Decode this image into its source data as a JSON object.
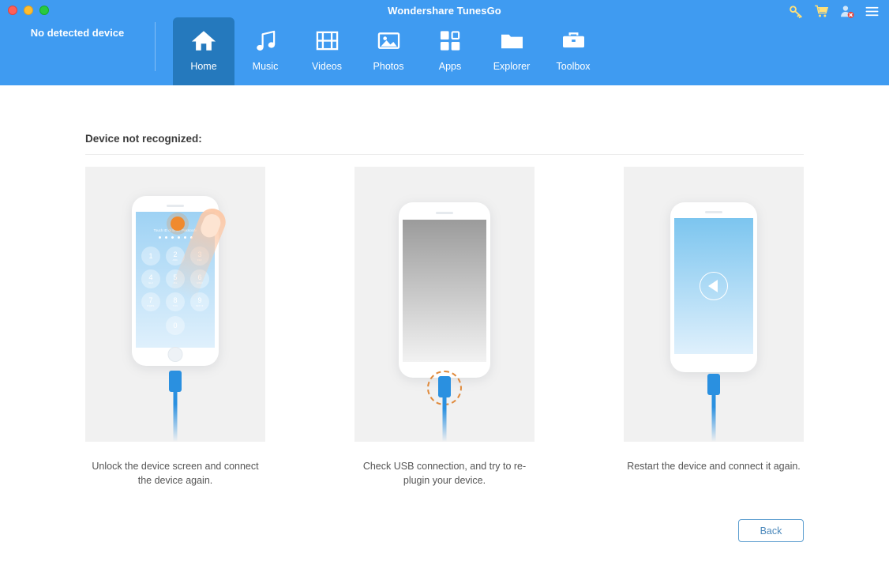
{
  "window": {
    "title": "Wondershare TunesGo",
    "traffic_lights": [
      {
        "name": "close",
        "color": "#ff5f57"
      },
      {
        "name": "minimize",
        "color": "#ffbd2e"
      },
      {
        "name": "maximize",
        "color": "#28c940"
      }
    ]
  },
  "header": {
    "background": "#3f9bf1",
    "active_tab_background": "#2579bd",
    "device_status": "No detected device",
    "actions": [
      {
        "icon": "key-icon",
        "label": "Register"
      },
      {
        "icon": "cart-icon",
        "label": "Buy Now"
      },
      {
        "icon": "user-disabled-icon",
        "label": "Account"
      },
      {
        "icon": "hamburger-menu-icon",
        "label": "Menu"
      }
    ],
    "nav": [
      {
        "id": "home",
        "label": "Home",
        "icon": "home-icon",
        "active": true
      },
      {
        "id": "music",
        "label": "Music",
        "icon": "music-note-icon",
        "active": false
      },
      {
        "id": "videos",
        "label": "Videos",
        "icon": "film-strip-icon",
        "active": false
      },
      {
        "id": "photos",
        "label": "Photos",
        "icon": "image-icon",
        "active": false
      },
      {
        "id": "apps",
        "label": "Apps",
        "icon": "apps-grid-icon",
        "active": false
      },
      {
        "id": "explorer",
        "label": "Explorer",
        "icon": "folder-icon",
        "active": false
      },
      {
        "id": "toolbox",
        "label": "Toolbox",
        "icon": "briefcase-icon",
        "active": false
      }
    ]
  },
  "main": {
    "section_title": "Device not recognized:",
    "cards": [
      {
        "id": "unlock",
        "illustration": "phone-lockscreen-finger-tap",
        "caption": "Unlock the device screen and connect the device again.",
        "lock_screen": {
          "prompt": "Touch ID or Enter Passcode",
          "dot_count": 6,
          "keys": [
            {
              "digit": "1",
              "letters": ""
            },
            {
              "digit": "2",
              "letters": "ABC"
            },
            {
              "digit": "3",
              "letters": "DEF"
            },
            {
              "digit": "4",
              "letters": "GHI"
            },
            {
              "digit": "5",
              "letters": "JKL"
            },
            {
              "digit": "6",
              "letters": "MNO"
            },
            {
              "digit": "7",
              "letters": "PQRS"
            },
            {
              "digit": "8",
              "letters": "TUV"
            },
            {
              "digit": "9",
              "letters": "WXYZ"
            },
            {
              "digit": "0",
              "letters": ""
            }
          ]
        }
      },
      {
        "id": "usb",
        "illustration": "phone-gray-screen-usb-highlight",
        "caption": "Check USB connection, and try to re-plugin your device."
      },
      {
        "id": "restart",
        "illustration": "phone-blue-screen-restart",
        "caption": "Restart the device and connect it again."
      }
    ]
  },
  "footer": {
    "back_label": "Back",
    "back_color": "#4b88bb"
  }
}
